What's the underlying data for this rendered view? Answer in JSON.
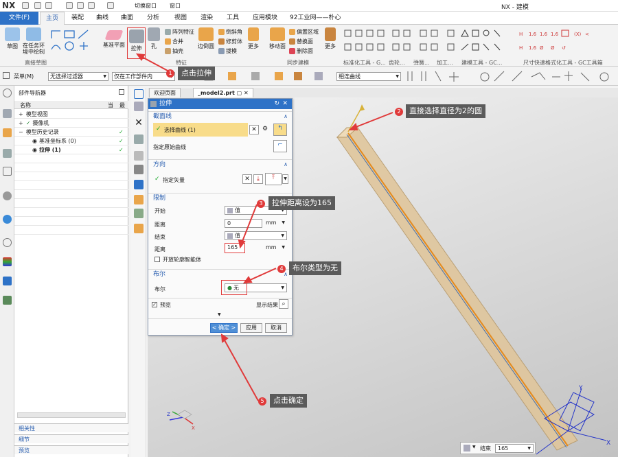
{
  "app": {
    "logo": "NX",
    "title": "NX - 建模",
    "quick_window": "切换窗口",
    "window_menu": "窗口"
  },
  "tabs": [
    "文件(F)",
    "主页",
    "装配",
    "曲线",
    "曲面",
    "分析",
    "视图",
    "渲染",
    "工具",
    "应用模块",
    "92工业网——朴心"
  ],
  "ribbon": {
    "sketch": "草图",
    "task_sketch": "在任务环境中绘制",
    "group_direct_sketch": "直接草图",
    "datum_plane": "基准平面",
    "extrude": "拉伸",
    "hole": "孔",
    "pattern_feature": "阵列特征",
    "unite": "合并",
    "shell": "抽壳",
    "edge_blend": "边倒圆",
    "chamfer": "倒斜角",
    "trim_body": "修剪体",
    "draft": "拔模",
    "more1": "更多",
    "move_face": "移动面",
    "offset_region": "偏置区域",
    "replace_face": "替换面",
    "delete_face": "删除面",
    "more2": "更多",
    "group_feature": "特征",
    "group_sync": "同步建模",
    "group_std": "标准化工具 - G...",
    "group_edge": "齿轮...",
    "group_spring": "弹簧...",
    "group_machining": "加工...",
    "group_modeling_tools": "建模工具 - GC...",
    "group_dimension": "尺寸快速格式化工具 - GC工具箱"
  },
  "toolbar2": {
    "menu": "菜单(M)",
    "filter": "无选择过滤器",
    "scope": "仅在工作部件内",
    "curve_rule": "相连曲线"
  },
  "navigator": {
    "title": "部件导航器",
    "col_name": "名称",
    "col_current": "当",
    "col_latest": "最",
    "items": [
      {
        "label": "模型视图"
      },
      {
        "label": "摄像机"
      },
      {
        "label": "模型历史记录"
      },
      {
        "label": "基准坐标系 (0)"
      },
      {
        "label": "拉伸 (1)"
      }
    ],
    "bottom": [
      "相关性",
      "细节",
      "预览"
    ]
  },
  "doc_tabs": [
    "欢迎页面",
    "_model2.prt"
  ],
  "dialog": {
    "title": "拉伸",
    "section_curve": "截面线",
    "select_curve": "选择曲线 (1)",
    "specify_origin": "指定原始曲线",
    "section_direction": "方向",
    "specify_vector": "指定矢量",
    "section_limits": "限制",
    "start_label": "开始",
    "start_value": "值",
    "dist1_label": "距离",
    "dist1_value": "0",
    "unit1": "mm",
    "end_label": "结束",
    "end_value": "值",
    "dist2_label": "距离",
    "dist2_value": "165",
    "unit2": "mm",
    "open_profile": "开放轮廓智能体",
    "section_bool": "布尔",
    "bool_label": "布尔",
    "bool_value": "无",
    "preview": "预览",
    "show_result": "显示结果",
    "ok": "< 确定 >",
    "apply": "应用",
    "cancel": "取消"
  },
  "viewport_bar": {
    "end_label": "结束",
    "end_value": "165"
  },
  "axes": {
    "x": "X",
    "y": "Y",
    "z": "Z"
  },
  "annotations": [
    {
      "num": "1",
      "text": "点击拉伸"
    },
    {
      "num": "2",
      "text": "直接选择直径为2的圆"
    },
    {
      "num": "3",
      "text": "拉伸距离设为165"
    },
    {
      "num": "4",
      "text": "布尔类型为无"
    },
    {
      "num": "5",
      "text": "点击确定"
    }
  ],
  "colors": {
    "accent": "#2e72c7",
    "annotation": "#e03a3a",
    "rod": "#d9b98a",
    "rod_line": "#e48a1d"
  }
}
